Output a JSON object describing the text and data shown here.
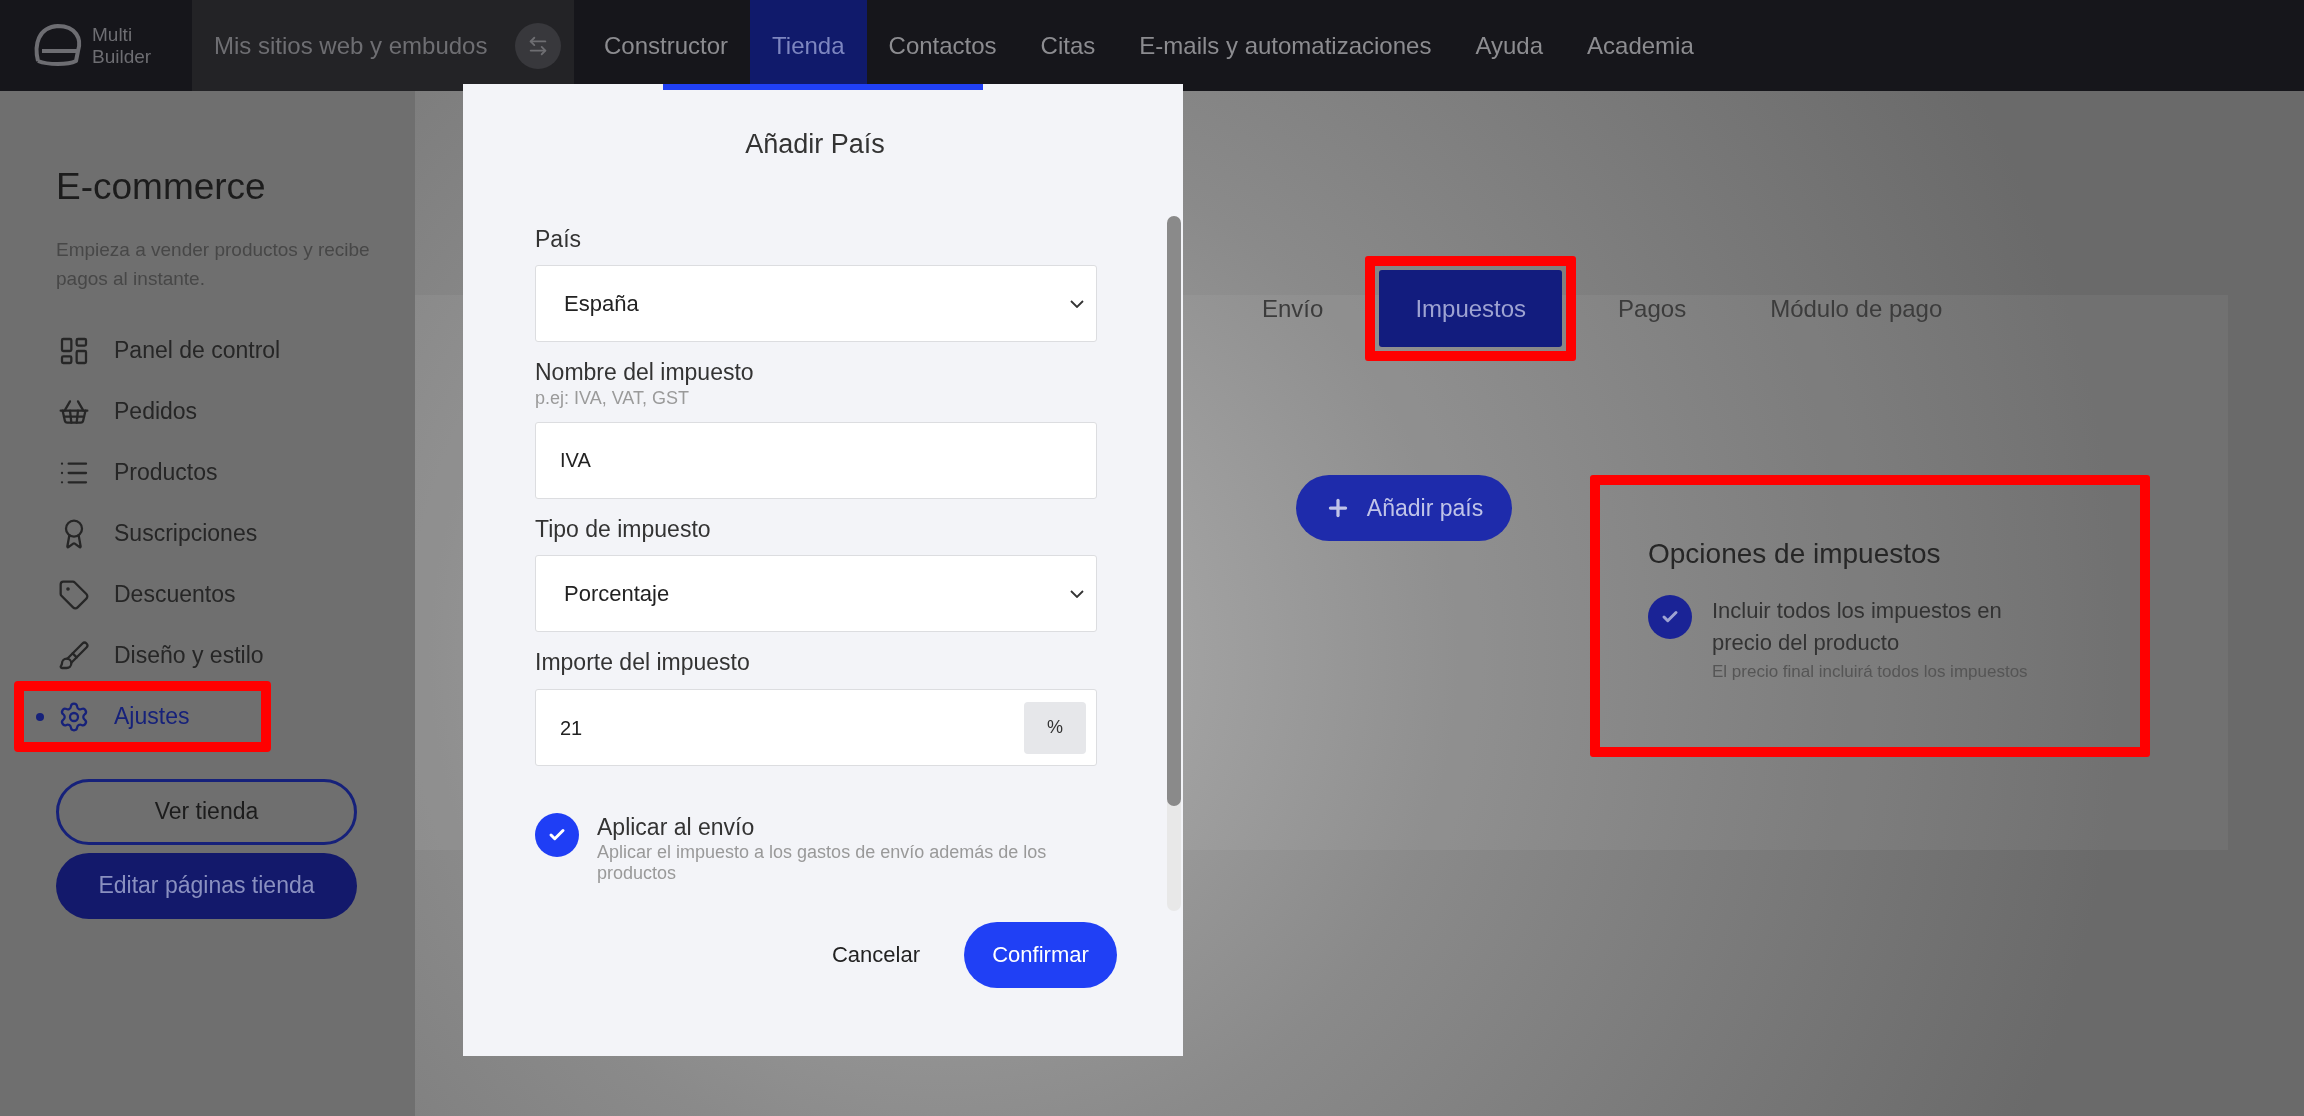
{
  "top_nav": {
    "logo": {
      "line1": "Multi",
      "line2": "Builder"
    },
    "sites_switcher": {
      "label": "Mis sitios web y embudos"
    },
    "items": [
      {
        "label": "Constructor",
        "selected": false
      },
      {
        "label": "Tienda",
        "selected": true
      },
      {
        "label": "Contactos",
        "selected": false
      },
      {
        "label": "Citas",
        "selected": false
      },
      {
        "label": "E-mails y automatizaciones",
        "selected": false
      },
      {
        "label": "Ayuda",
        "selected": false
      },
      {
        "label": "Academia",
        "selected": false
      }
    ]
  },
  "sidebar": {
    "title": "E-commerce",
    "description": "Empieza a vender productos y recibe pagos al instante.",
    "items": [
      {
        "label": "Panel de control",
        "selected": false,
        "highlighted": false
      },
      {
        "label": "Pedidos",
        "selected": false,
        "highlighted": false
      },
      {
        "label": "Productos",
        "selected": false,
        "highlighted": false
      },
      {
        "label": "Suscripciones",
        "selected": false,
        "highlighted": false
      },
      {
        "label": "Descuentos",
        "selected": false,
        "highlighted": false
      },
      {
        "label": "Diseño y estilo",
        "selected": false,
        "highlighted": false
      },
      {
        "label": "Ajustes",
        "selected": true,
        "highlighted": true
      }
    ],
    "buttons": [
      {
        "label": "Ver tienda",
        "kind": "outline"
      },
      {
        "label": "Editar páginas tienda",
        "kind": "filled"
      }
    ]
  },
  "tabs": [
    {
      "label": "Envío",
      "selected": false,
      "highlighted": false
    },
    {
      "label": "Impuestos",
      "selected": true,
      "highlighted": true
    },
    {
      "label": "Pagos",
      "selected": false,
      "highlighted": false
    },
    {
      "label": "Módulo de pago",
      "selected": false,
      "highlighted": false
    }
  ],
  "add_button": {
    "label": "Añadir país"
  },
  "tax_options": {
    "title": "Opciones de impuestos",
    "highlighted": true,
    "option": {
      "label": "Incluir todos los impuestos en precio del producto",
      "hint": "El precio final incluirá todos los impuestos",
      "checked": true
    }
  },
  "modal": {
    "title": "Añadir País",
    "fields": [
      {
        "kind": "select",
        "label": "País",
        "value": "España"
      },
      {
        "kind": "text",
        "label": "Nombre del impuesto",
        "hint": "p.ej: IVA, VAT, GST",
        "value": "IVA"
      },
      {
        "kind": "select",
        "label": "Tipo de impuesto",
        "value": "Porcentaje"
      },
      {
        "kind": "suffix",
        "label": "Importe del impuesto",
        "value": "21",
        "suffix": "%"
      }
    ],
    "checkbox": {
      "label": "Aplicar al envío",
      "hint": "Aplicar el impuesto a los gastos de envío además de los productos",
      "checked": true
    },
    "buttons": [
      {
        "label": "Cancelar",
        "kind": "text"
      },
      {
        "label": "Confirmar",
        "kind": "primary"
      }
    ]
  }
}
